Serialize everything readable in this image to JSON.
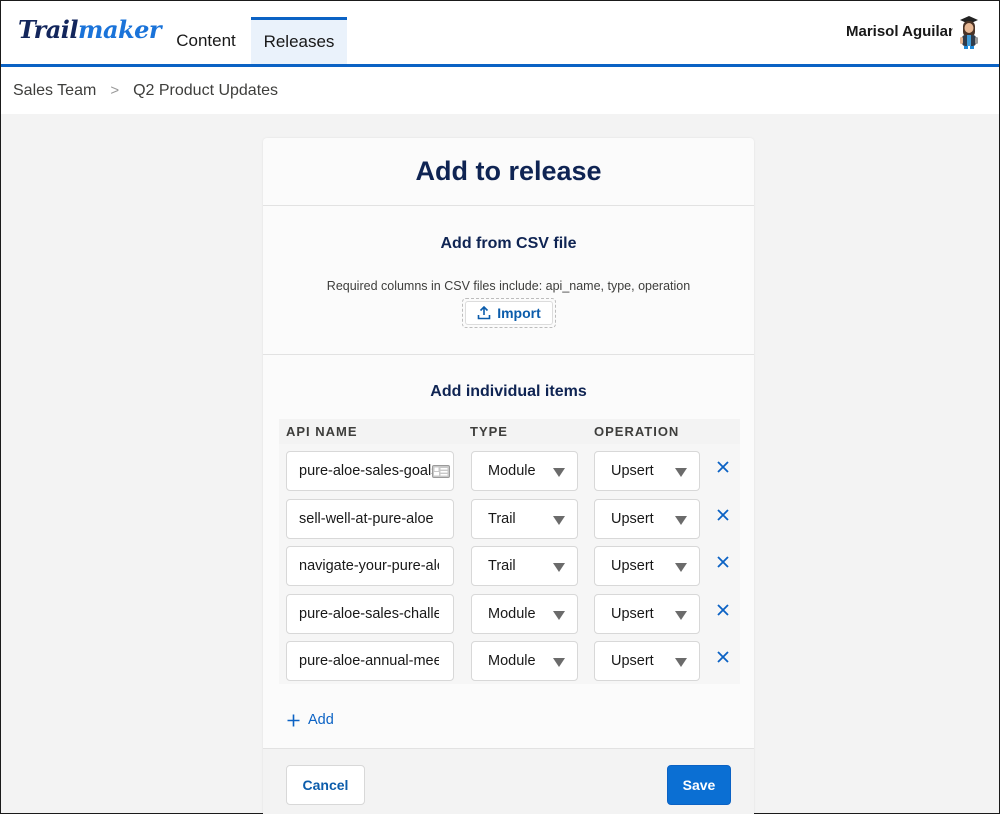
{
  "app": {
    "logo_part1": "Trail",
    "logo_part2": "maker",
    "tabs": [
      {
        "label": "Content",
        "active": false
      },
      {
        "label": "Releases",
        "active": true
      }
    ],
    "user_name": "Marisol Aguilar",
    "accent_color": "#0b62c4"
  },
  "breadcrumb": {
    "items": [
      "Sales Team",
      "Q2 Product Updates"
    ],
    "separator": ">"
  },
  "dialog": {
    "title": "Add to release",
    "csv": {
      "heading": "Add from CSV file",
      "help_text": "Required columns in CSV files include: api_name, type, operation",
      "import_label": "Import",
      "import_icon": "upload-icon"
    },
    "items": {
      "heading": "Add individual items",
      "columns": [
        "API NAME",
        "TYPE",
        "OPERATION"
      ],
      "rows": [
        {
          "api_name": "pure-aloe-sales-goals",
          "type": "Module",
          "operation": "Upsert",
          "has_card_icon": true
        },
        {
          "api_name": "sell-well-at-pure-aloe",
          "type": "Trail",
          "operation": "Upsert"
        },
        {
          "api_name": "navigate-your-pure-aloe",
          "type": "Trail",
          "operation": "Upsert"
        },
        {
          "api_name": "pure-aloe-sales-challenges",
          "type": "Module",
          "operation": "Upsert"
        },
        {
          "api_name": "pure-aloe-annual-meeting",
          "type": "Module",
          "operation": "Upsert"
        }
      ],
      "remove_icon": "close-icon",
      "add_label": "Add"
    },
    "footer": {
      "cancel_label": "Cancel",
      "save_label": "Save"
    }
  }
}
